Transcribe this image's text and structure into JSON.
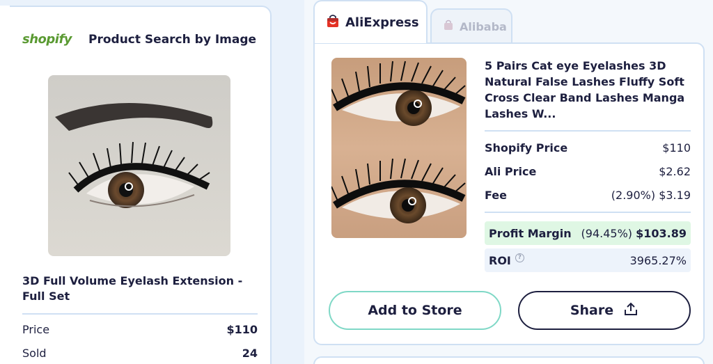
{
  "left_panel": {
    "logo_text": "shopify",
    "title": "Product Search by Image",
    "product_name": "3D Full Volume Eyelash Extension - Full Set",
    "rows": [
      {
        "label": "Price",
        "value": "$110"
      },
      {
        "label": "Sold",
        "value": "24"
      }
    ]
  },
  "tabs": [
    {
      "label": "AliExpress",
      "icon": "aliexpress-bag-icon",
      "active": true
    },
    {
      "label": "Alibaba",
      "icon": "alibaba-bag-icon",
      "active": false
    }
  ],
  "result_card": {
    "title": "5 Pairs Cat eye Eyelashes 3D Natural False Lashes Fluffy Soft Cross Clear Band Lashes Manga Lashes W...",
    "rows": [
      {
        "label": "Shopify Price",
        "value": "$110"
      },
      {
        "label": "Ali Price",
        "value": "$2.62"
      },
      {
        "label": "Fee",
        "value": "(2.90%) $3.19"
      }
    ],
    "profit": {
      "label": "Profit Margin",
      "percent": "(94.45%)",
      "amount": "$103.89"
    },
    "roi": {
      "label": "ROI",
      "help_icon": "?",
      "value": "3965.27%"
    },
    "add_button": "Add to Store",
    "share_button": "Share"
  },
  "colors": {
    "accent_green": "#7fd8c6",
    "profit_bg": "#dff7e4",
    "border": "#cfe0f3",
    "text": "#1d1f3f",
    "shopify_green": "#5a9a32",
    "aliexpress_red": "#e43225"
  }
}
